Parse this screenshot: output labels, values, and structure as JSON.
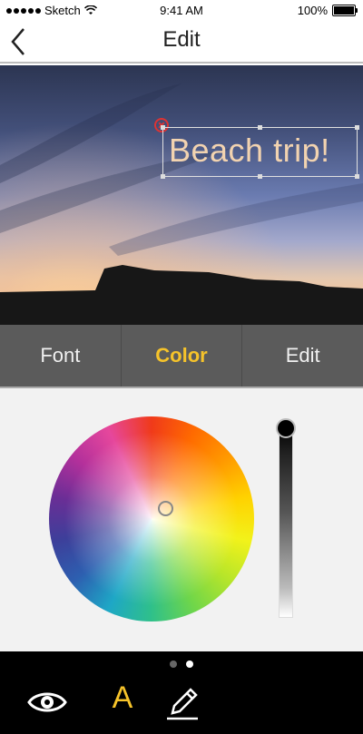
{
  "status": {
    "carrier": "Sketch",
    "time": "9:41 AM",
    "battery": "100%"
  },
  "nav": {
    "title": "Edit",
    "back_icon": "chevron-left-icon"
  },
  "photo": {
    "overlay_text": "Beach trip!"
  },
  "tabs": [
    {
      "label": "Font",
      "active": false
    },
    {
      "label": "Color",
      "active": true
    },
    {
      "label": "Edit",
      "active": false
    }
  ],
  "accent_color": "#f6c32a",
  "toolbar": {
    "text_tool_label": "A",
    "icons": [
      "eye-icon",
      "text-icon",
      "pen-icon"
    ]
  },
  "pager": {
    "pages": 2,
    "current": 2
  }
}
